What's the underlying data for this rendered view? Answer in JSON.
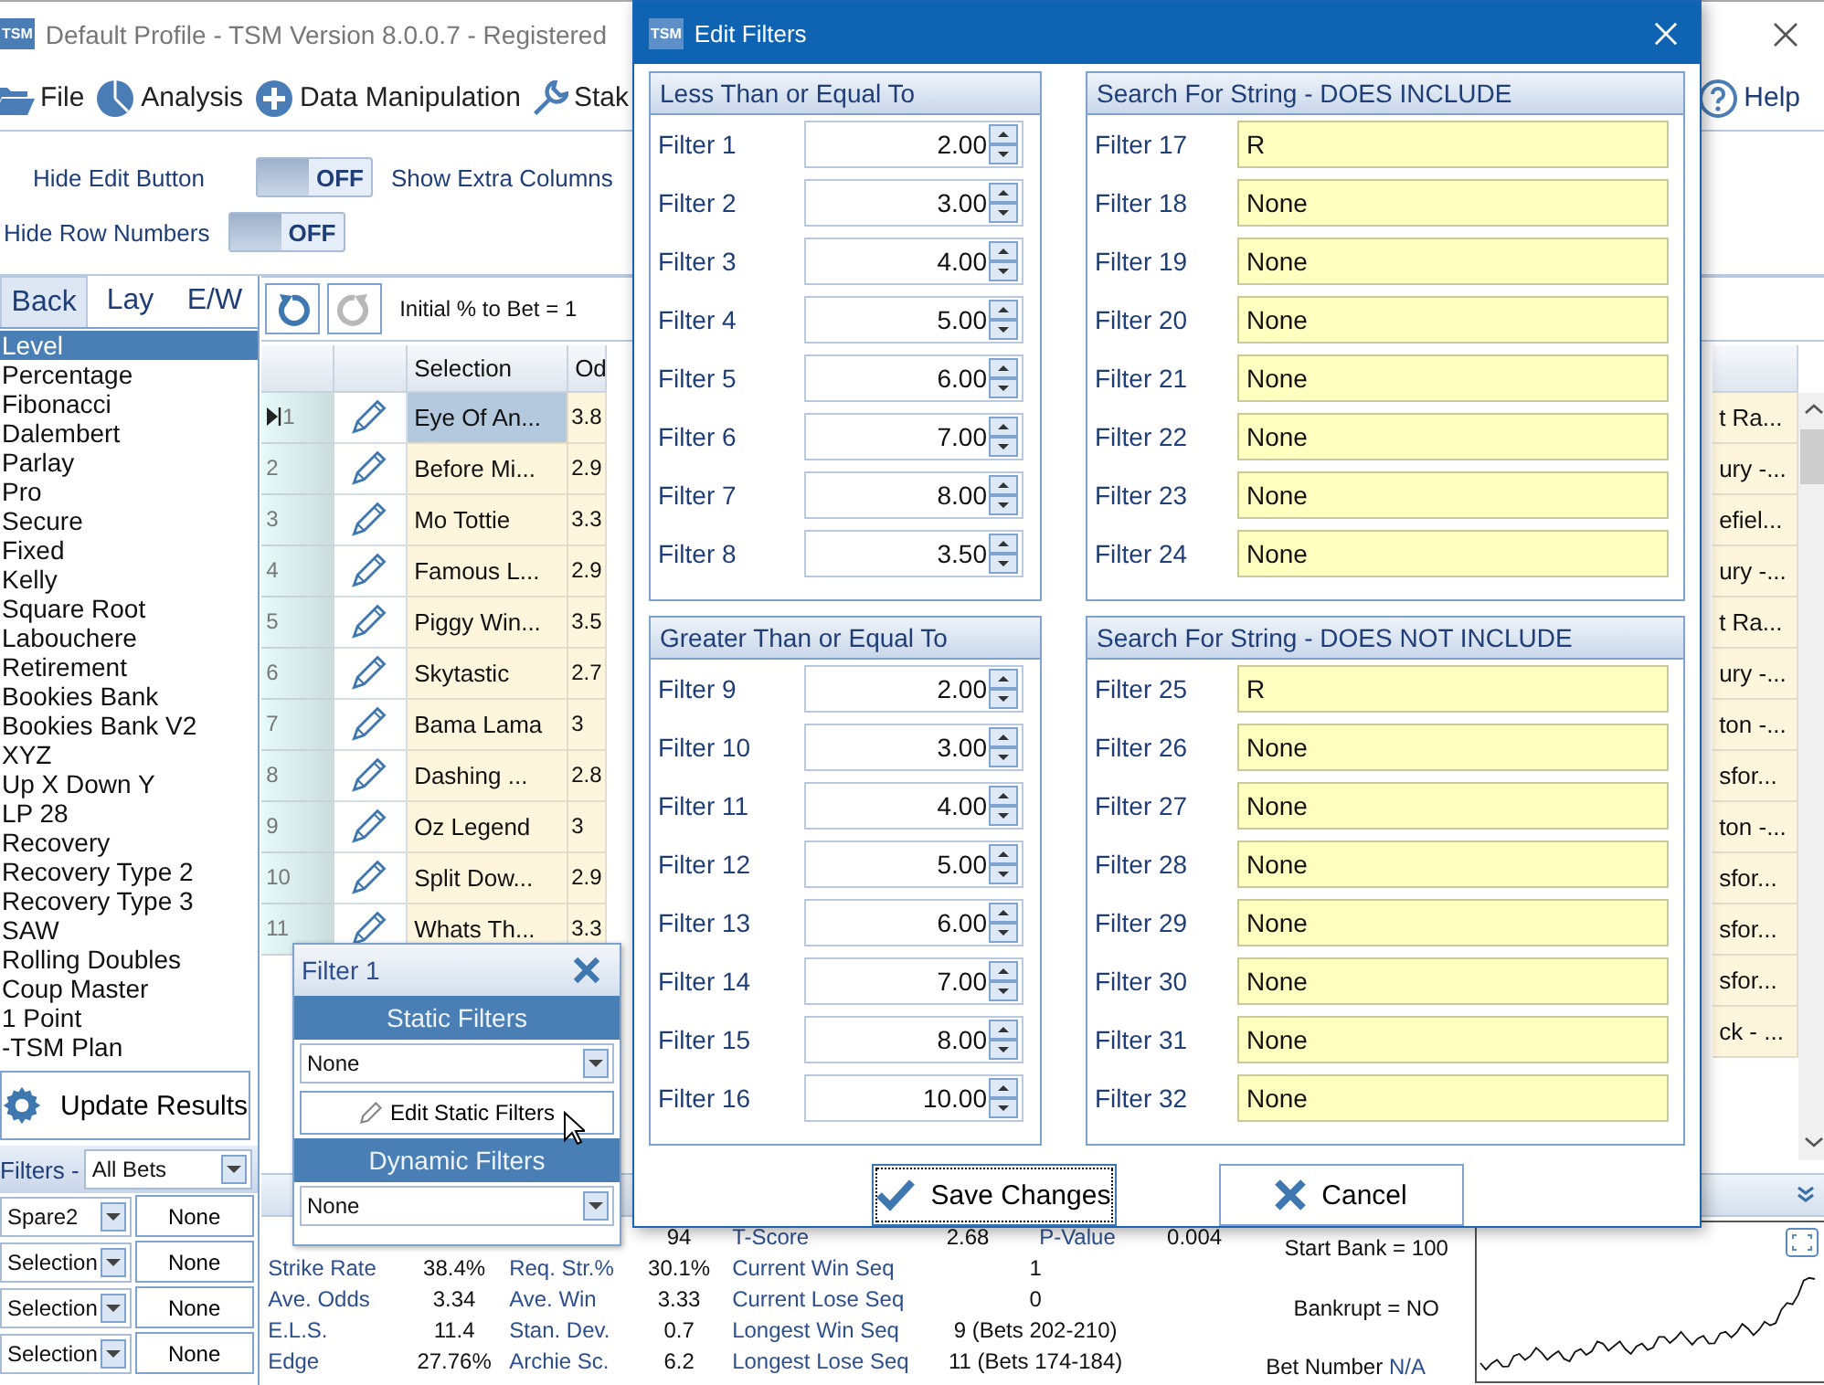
{
  "window": {
    "badge": "TSM",
    "title": "Default Profile  - TSM Version 8.0.0.7 - Registered"
  },
  "menu": [
    {
      "label": "File",
      "kind": "folder"
    },
    {
      "label": "Analysis",
      "kind": "pie"
    },
    {
      "label": "Data Manipulation",
      "kind": "plus"
    },
    {
      "label": "Stak",
      "kind": "wrench"
    }
  ],
  "help": {
    "label": "Help"
  },
  "options": [
    [
      {
        "label": "Hide Edit Button",
        "toggle": {
          "on": false,
          "text": "OFF"
        }
      },
      {
        "label": "Show Extra Columns"
      }
    ],
    [
      {
        "label": "Hide Row Numbers",
        "toggle": {
          "on": false,
          "text": "OFF"
        }
      }
    ]
  ],
  "bet_tabs": [
    {
      "label": "Back",
      "selected": true
    },
    {
      "label": "Lay",
      "selected": false
    },
    {
      "label": "E/W",
      "selected": false
    }
  ],
  "plans": [
    {
      "label": "Level",
      "selected": true
    },
    {
      "label": "Percentage",
      "selected": false
    },
    {
      "label": "Fibonacci",
      "selected": false
    },
    {
      "label": "Dalembert",
      "selected": false
    },
    {
      "label": "Parlay",
      "selected": false
    },
    {
      "label": "Pro",
      "selected": false
    },
    {
      "label": "Secure",
      "selected": false
    },
    {
      "label": "Fixed",
      "selected": false
    },
    {
      "label": "Kelly",
      "selected": false
    },
    {
      "label": "Square Root",
      "selected": false
    },
    {
      "label": "Labouchere",
      "selected": false
    },
    {
      "label": "Retirement",
      "selected": false
    },
    {
      "label": "Bookies Bank",
      "selected": false
    },
    {
      "label": "Bookies Bank V2",
      "selected": false
    },
    {
      "label": "XYZ",
      "selected": false
    },
    {
      "label": "Up X Down Y",
      "selected": false
    },
    {
      "label": "LP 28",
      "selected": false
    },
    {
      "label": "Recovery",
      "selected": false
    },
    {
      "label": "Recovery Type 2",
      "selected": false
    },
    {
      "label": "Recovery Type 3",
      "selected": false
    },
    {
      "label": "SAW",
      "selected": false
    },
    {
      "label": "Rolling Doubles",
      "selected": false
    },
    {
      "label": "Coup Master",
      "selected": false
    },
    {
      "label": "1 Point",
      "selected": false
    },
    {
      "label": "-TSM Plan",
      "selected": false
    }
  ],
  "update_button": {
    "label": "Update Results"
  },
  "filters": {
    "label": "Filters -",
    "value": "All Bets",
    "rows": [
      {
        "field": "Spare2",
        "value": "None"
      },
      {
        "field": "Selection",
        "value": "None"
      },
      {
        "field": "Selection",
        "value": "None"
      },
      {
        "field": "Selection",
        "value": "None"
      }
    ]
  },
  "toolbar": {
    "buttons": [
      {
        "kind": "undo",
        "disabled": false
      },
      {
        "kind": "redo",
        "disabled": true
      }
    ],
    "initial_bet": "Initial % to Bet = 1"
  },
  "table": {
    "columns": [
      "Selection",
      "Od"
    ],
    "rows": [
      {
        "number": "1",
        "current": true,
        "selected": true,
        "selection": "Eye Of An...",
        "odds": "3.8"
      },
      {
        "number": "2",
        "current": false,
        "selected": false,
        "selection": "Before Mi...",
        "odds": "2.9"
      },
      {
        "number": "3",
        "current": false,
        "selected": false,
        "selection": "Mo Tottie",
        "odds": "3.3"
      },
      {
        "number": "4",
        "current": false,
        "selected": false,
        "selection": "Famous L...",
        "odds": "2.9"
      },
      {
        "number": "5",
        "current": false,
        "selected": false,
        "selection": "Piggy Win...",
        "odds": "3.5"
      },
      {
        "number": "6",
        "current": false,
        "selected": false,
        "selection": "Skytastic",
        "odds": "2.7"
      },
      {
        "number": "7",
        "current": false,
        "selected": false,
        "selection": "Bama Lama",
        "odds": "3"
      },
      {
        "number": "8",
        "current": false,
        "selected": false,
        "selection": "Dashing ...",
        "odds": "2.8"
      },
      {
        "number": "9",
        "current": false,
        "selected": false,
        "selection": "Oz Legend",
        "odds": "3"
      },
      {
        "number": "10",
        "current": false,
        "selected": false,
        "selection": "Split Dow...",
        "odds": "2.9"
      },
      {
        "number": "11",
        "current": false,
        "selected": false,
        "selection": "Whats Th...",
        "odds": "3.3"
      }
    ],
    "right_column_cells": [
      "t Ra...",
      "ury -...",
      "efiel...",
      "ury -...",
      "t Ra...",
      "ury -...",
      "ton -...",
      "sfor...",
      "ton -...",
      "sfor...",
      "sfor...",
      "sfor...",
      "ck - ..."
    ]
  },
  "stats": [
    {
      "b": {
        "value": "94"
      },
      "c": {
        "label": "T-Score",
        "value": "2.68"
      },
      "d": {
        "label": "P-Value",
        "value": "0.004"
      }
    },
    {
      "a": {
        "label": "Strike Rate",
        "value": "38.4%"
      },
      "b": {
        "label": "Req. Str.%",
        "value": "30.1%"
      },
      "c": {
        "label": "Current Win Seq",
        "value": "1"
      }
    },
    {
      "a": {
        "label": "Ave. Odds",
        "value": "3.34"
      },
      "b": {
        "label": "Ave. Win",
        "value": "3.33"
      },
      "c": {
        "label": "Current Lose Seq",
        "value": "0"
      }
    },
    {
      "a": {
        "label": "E.L.S.",
        "value": "11.4"
      },
      "b": {
        "label": "Stan. Dev.",
        "value": "0.7"
      },
      "c": {
        "label": "Longest Win Seq",
        "value": "9  (Bets 202-210)"
      }
    },
    {
      "a": {
        "label": "Edge",
        "value": "27.76%"
      },
      "b": {
        "label": "Archie Sc.",
        "value": "6.2"
      },
      "c": {
        "label": "Longest Lose Seq",
        "value": "11  (Bets 174-184)"
      }
    }
  ],
  "bank": {
    "start": "Start Bank = 100",
    "bankrupt": "Bankrupt = NO",
    "bet_number_label": "Bet Number",
    "bet_number": "N/A"
  },
  "filter_popup": {
    "title": "Filter 1",
    "static_header": "Static Filters",
    "static_value": "None",
    "edit_button": "Edit Static Filters",
    "dynamic_header": "Dynamic Filters",
    "dynamic_value": "None"
  },
  "dialog": {
    "badge": "TSM",
    "title": "Edit Filters",
    "groups": [
      {
        "title": "Less Than or Equal To",
        "kind": "number",
        "filters": [
          {
            "label": "Filter 1",
            "value": "2.00"
          },
          {
            "label": "Filter 2",
            "value": "3.00"
          },
          {
            "label": "Filter 3",
            "value": "4.00"
          },
          {
            "label": "Filter 4",
            "value": "5.00"
          },
          {
            "label": "Filter 5",
            "value": "6.00"
          },
          {
            "label": "Filter 6",
            "value": "7.00"
          },
          {
            "label": "Filter 7",
            "value": "8.00"
          },
          {
            "label": "Filter 8",
            "value": "3.50"
          }
        ]
      },
      {
        "title": "Search For String - DOES INCLUDE",
        "kind": "text",
        "filters": [
          {
            "label": "Filter 17",
            "value": "R"
          },
          {
            "label": "Filter 18",
            "value": "None"
          },
          {
            "label": "Filter 19",
            "value": "None"
          },
          {
            "label": "Filter 20",
            "value": "None"
          },
          {
            "label": "Filter 21",
            "value": "None"
          },
          {
            "label": "Filter 22",
            "value": "None"
          },
          {
            "label": "Filter 23",
            "value": "None"
          },
          {
            "label": "Filter 24",
            "value": "None"
          }
        ]
      },
      {
        "title": "Greater Than or Equal To",
        "kind": "number",
        "filters": [
          {
            "label": "Filter 9",
            "value": "2.00"
          },
          {
            "label": "Filter 10",
            "value": "3.00"
          },
          {
            "label": "Filter 11",
            "value": "4.00"
          },
          {
            "label": "Filter 12",
            "value": "5.00"
          },
          {
            "label": "Filter 13",
            "value": "6.00"
          },
          {
            "label": "Filter 14",
            "value": "7.00"
          },
          {
            "label": "Filter 15",
            "value": "8.00"
          },
          {
            "label": "Filter 16",
            "value": "10.00"
          }
        ]
      },
      {
        "title": "Search For String - DOES NOT INCLUDE",
        "kind": "text",
        "filters": [
          {
            "label": "Filter 25",
            "value": "R"
          },
          {
            "label": "Filter 26",
            "value": "None"
          },
          {
            "label": "Filter 27",
            "value": "None"
          },
          {
            "label": "Filter 28",
            "value": "None"
          },
          {
            "label": "Filter 29",
            "value": "None"
          },
          {
            "label": "Filter 30",
            "value": "None"
          },
          {
            "label": "Filter 31",
            "value": "None"
          },
          {
            "label": "Filter 32",
            "value": "None"
          }
        ]
      }
    ],
    "buttons": [
      {
        "label": "Save Changes",
        "kind": "save",
        "focused": true
      },
      {
        "label": "Cancel",
        "kind": "cancel",
        "focused": false
      }
    ]
  }
}
